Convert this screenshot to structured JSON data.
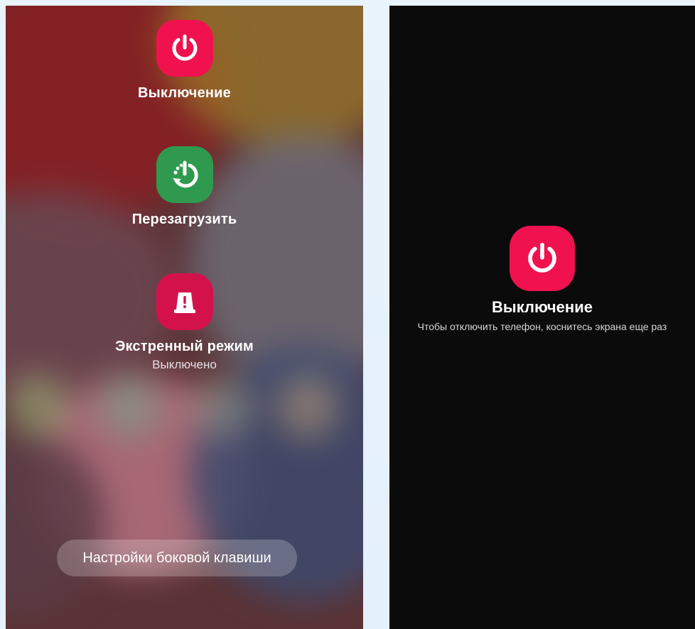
{
  "power_menu": {
    "items": [
      {
        "label": "Выключение",
        "sublabel": "",
        "icon": "power-icon",
        "color": "#f0124f"
      },
      {
        "label": "Перезагрузить",
        "sublabel": "",
        "icon": "restart-icon",
        "color": "#2f9a4f"
      },
      {
        "label": "Экстренный режим",
        "sublabel": "Выключено",
        "icon": "emergency-icon",
        "color": "#d3124b"
      }
    ],
    "side_key_settings_label": "Настройки боковой клавиши"
  },
  "confirm_screen": {
    "title": "Выключение",
    "hint": "Чтобы отключить телефон, коснитесь экрана еще раз",
    "icon": "power-icon",
    "color": "#f0124f"
  }
}
